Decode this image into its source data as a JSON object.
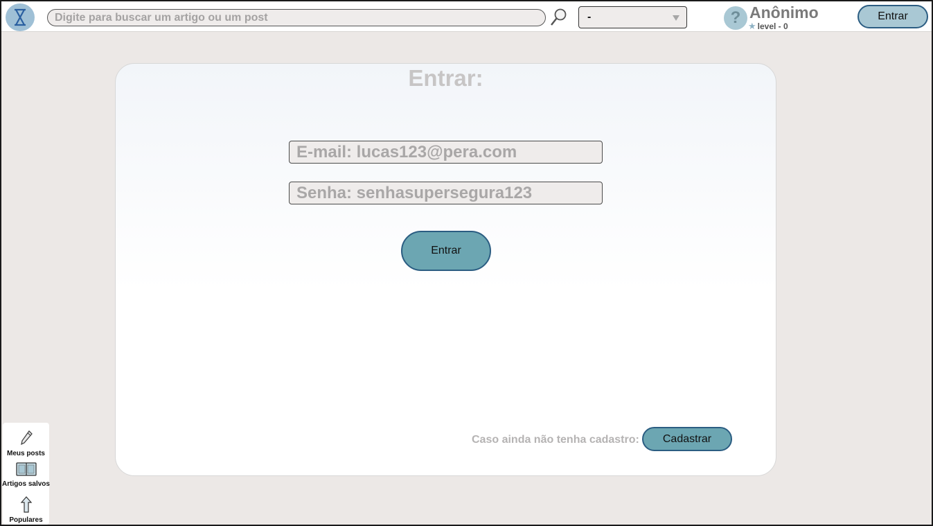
{
  "header": {
    "search_placeholder": "Digite para buscar um artigo ou um post",
    "select_value": "-",
    "help_symbol": "?",
    "user_name": "Anônimo",
    "user_level": "level - 0",
    "login_label": "Entrar"
  },
  "login_form": {
    "title": "Entrar:",
    "email_placeholder": "E-mail: lucas123@pera.com",
    "password_placeholder": "Senha: senhasupersegura123",
    "submit_label": "Entrar",
    "signup_prompt": "Caso ainda não tenha cadastro:",
    "signup_label": "Cadastrar"
  },
  "dock": {
    "items": [
      {
        "label": "Meus posts",
        "icon": "pencil-icon"
      },
      {
        "label": "Artigos salvos",
        "icon": "book-icon"
      },
      {
        "label": "Populares",
        "icon": "arrow-up-icon"
      }
    ]
  },
  "colors": {
    "background": "#ece8e6",
    "accent": "#6ca6b2",
    "accent_light": "#a9c8d4",
    "border_accent": "#2b5d82"
  }
}
